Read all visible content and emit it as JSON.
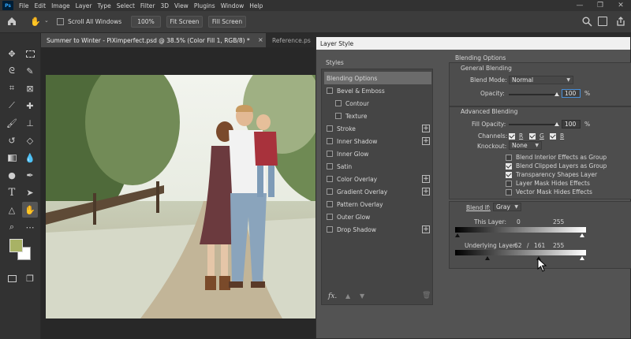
{
  "menu": [
    "File",
    "Edit",
    "Image",
    "Layer",
    "Type",
    "Select",
    "Filter",
    "3D",
    "View",
    "Plugins",
    "Window",
    "Help"
  ],
  "app_logo": "Ps",
  "options_bar": {
    "scroll_all": "Scroll All Windows",
    "zoom": "100%",
    "fit_screen": "Fit Screen",
    "fill_screen": "Fill Screen"
  },
  "tabs": {
    "active": "Summer to Winter - PiXimperfect.psd @ 38.5% (Color Fill 1, RGB/8) *",
    "close": "×",
    "second": "Reference.ps"
  },
  "dialog": {
    "title": "Layer Style",
    "styles_header": "Styles",
    "styles": [
      {
        "label": "Blending Options",
        "selected": true
      },
      {
        "label": "Bevel & Emboss",
        "check": true
      },
      {
        "label": "Contour",
        "check": true,
        "indent": true
      },
      {
        "label": "Texture",
        "check": true,
        "indent": true
      },
      {
        "label": "Stroke",
        "check": true,
        "plus": true
      },
      {
        "label": "Inner Shadow",
        "check": true,
        "plus": true
      },
      {
        "label": "Inner Glow",
        "check": true
      },
      {
        "label": "Satin",
        "check": true
      },
      {
        "label": "Color Overlay",
        "check": true,
        "plus": true
      },
      {
        "label": "Gradient Overlay",
        "check": true,
        "plus": true
      },
      {
        "label": "Pattern Overlay",
        "check": true
      },
      {
        "label": "Outer Glow",
        "check": true
      },
      {
        "label": "Drop Shadow",
        "check": true,
        "plus": true
      }
    ],
    "fx": "fx.",
    "blending_options": "Blending Options",
    "general_blending": "General Blending",
    "blend_mode_label": "Blend Mode:",
    "blend_mode": "Normal",
    "opacity_label": "Opacity:",
    "opacity": "100",
    "percent": "%",
    "advanced_blending": "Advanced Blending",
    "fill_opacity_label": "Fill Opacity:",
    "fill_opacity": "100",
    "channels_label": "Channels:",
    "channels": [
      "R",
      "G",
      "B"
    ],
    "knockout_label": "Knockout:",
    "knockout": "None",
    "adv_checks": [
      {
        "label": "Blend Interior Effects as Group",
        "checked": false
      },
      {
        "label": "Blend Clipped Layers as Group",
        "checked": true
      },
      {
        "label": "Transparency Shapes Layer",
        "checked": true
      },
      {
        "label": "Layer Mask Hides Effects",
        "checked": false
      },
      {
        "label": "Vector Mask Hides Effects",
        "checked": false
      }
    ],
    "blend_if_label": "Blend If:",
    "blend_if": "Gray",
    "this_layer_label": "This Layer:",
    "this_layer_low": "0",
    "this_layer_high": "255",
    "underlying_label": "Underlying Layer:",
    "underlying_low": "62",
    "underlying_slash": "/",
    "underlying_mid": "161",
    "underlying_high": "255"
  }
}
